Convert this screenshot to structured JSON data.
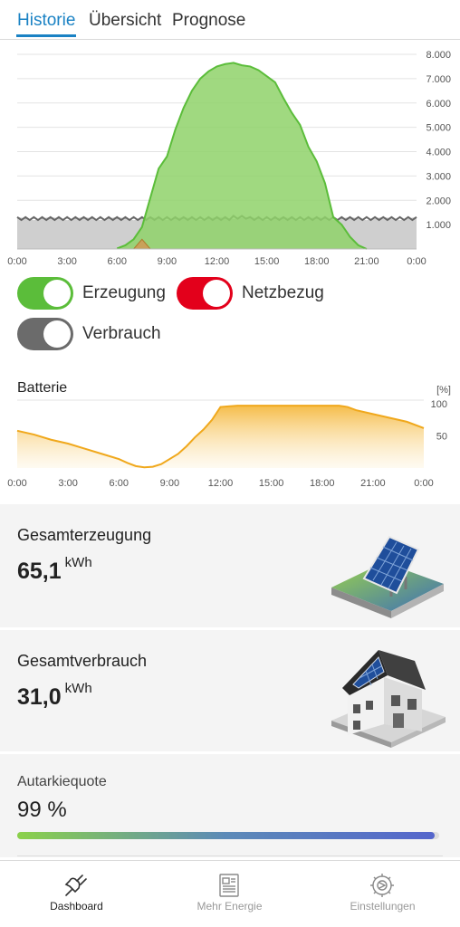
{
  "tabs": [
    {
      "label": "Historie",
      "active": true
    },
    {
      "label": "Übersicht",
      "active": false
    },
    {
      "label": "Prognose",
      "active": false
    }
  ],
  "toggles": [
    {
      "label": "Erzeugung",
      "color": "#5bbd3a",
      "on": true
    },
    {
      "label": "Netzbezug",
      "color": "#e3001b",
      "on": true
    },
    {
      "label": "Verbrauch",
      "color": "#6b6b6b",
      "on": true
    }
  ],
  "battery_title": "Batterie",
  "cards": {
    "production": {
      "title": "Gesamterzeugung",
      "value": "65,1",
      "unit": "kWh"
    },
    "consumption": {
      "title": "Gesamtverbrauch",
      "value": "31,0",
      "unit": "kWh"
    },
    "autarky": {
      "title": "Autarkiequote",
      "value": "99 %",
      "fraction": 0.99
    }
  },
  "nav": [
    {
      "label": "Dashboard",
      "icon": "plug-icon",
      "active": true
    },
    {
      "label": "Mehr Energie",
      "icon": "newspaper-icon",
      "active": false
    },
    {
      "label": "Einstellungen",
      "icon": "settings-gear-icon",
      "active": false
    }
  ],
  "chart_data": [
    {
      "type": "area",
      "x_ticks": [
        "0:00",
        "3:00",
        "6:00",
        "9:00",
        "12:00",
        "15:00",
        "18:00",
        "21:00",
        "0:00"
      ],
      "y_ticks": [
        "1.000",
        "2.000",
        "3.000",
        "4.000",
        "5.000",
        "6.000",
        "7.000",
        "8.000"
      ],
      "ylim": [
        0,
        8000
      ],
      "xlim": [
        0,
        24
      ],
      "grid": true,
      "series": [
        {
          "name": "Erzeugung",
          "color": "#5bbd3a",
          "x": [
            6.0,
            6.5,
            7.0,
            7.5,
            8.0,
            8.5,
            9.0,
            9.5,
            10.0,
            10.5,
            11.0,
            11.5,
            12.0,
            12.5,
            13.0,
            13.5,
            14.0,
            14.5,
            15.0,
            15.5,
            16.0,
            16.5,
            17.0,
            17.5,
            18.0,
            18.5,
            19.0,
            19.5,
            20.0,
            20.5,
            21.0
          ],
          "values": [
            20,
            150,
            400,
            900,
            2100,
            3300,
            3800,
            4900,
            5800,
            6500,
            7000,
            7300,
            7500,
            7600,
            7650,
            7550,
            7500,
            7350,
            7100,
            6850,
            6200,
            5600,
            5100,
            4200,
            3600,
            2700,
            1300,
            1000,
            500,
            150,
            0
          ]
        },
        {
          "name": "Netzbezug",
          "color": "#b07a2a",
          "x": [
            7.0,
            7.5,
            8.0
          ],
          "values": [
            0,
            400,
            0
          ]
        },
        {
          "name": "Verbrauch",
          "color": "#6b6b6b",
          "x": [
            0,
            1,
            2,
            3,
            4,
            5,
            6,
            7,
            8,
            9,
            10,
            11,
            12,
            13,
            14,
            15,
            16,
            17,
            18,
            19,
            20,
            21,
            22,
            23,
            24
          ],
          "values": [
            1250,
            1250,
            1250,
            1250,
            1250,
            1250,
            1250,
            1250,
            1250,
            1250,
            1250,
            1250,
            1250,
            1300,
            1250,
            1250,
            1250,
            1250,
            1250,
            1250,
            1250,
            1250,
            1250,
            1250,
            1250
          ]
        }
      ]
    },
    {
      "type": "area",
      "title": "Batterie",
      "unit": "[%]",
      "x_ticks": [
        "0:00",
        "3:00",
        "6:00",
        "9:00",
        "12:00",
        "15:00",
        "18:00",
        "21:00",
        "0:00"
      ],
      "y_ticks": [
        "50",
        "100"
      ],
      "ylim": [
        0,
        100
      ],
      "xlim": [
        0,
        24
      ],
      "grid": false,
      "series": [
        {
          "name": "Batterie",
          "color": "#f0a81c",
          "x": [
            0,
            1,
            2,
            3,
            4,
            5,
            6,
            6.5,
            7,
            7.5,
            8,
            8.5,
            9,
            9.5,
            10,
            10.5,
            11,
            11.5,
            12,
            13,
            14,
            15,
            16,
            17,
            18,
            19,
            19.5,
            20,
            21,
            22,
            23,
            24
          ],
          "values": [
            58,
            52,
            44,
            38,
            30,
            22,
            14,
            8,
            3,
            1,
            2,
            6,
            14,
            22,
            34,
            48,
            60,
            75,
            95,
            97,
            97,
            97,
            97,
            97,
            97,
            97,
            95,
            90,
            84,
            78,
            72,
            62
          ]
        }
      ]
    }
  ]
}
